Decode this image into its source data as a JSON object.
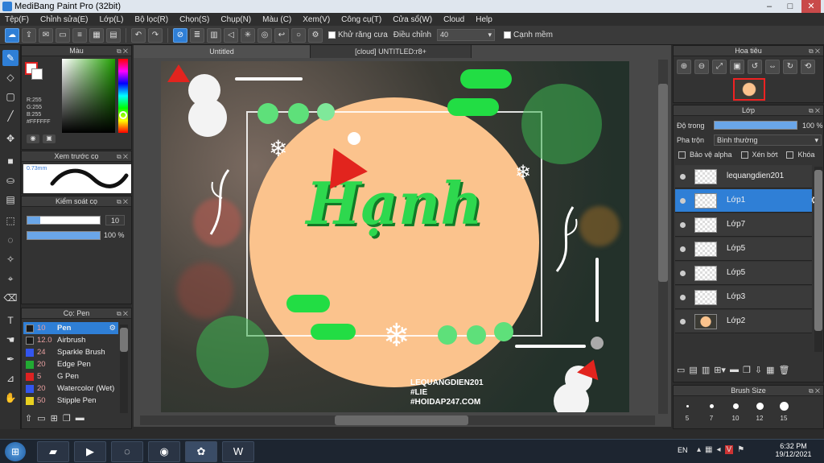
{
  "titlebar": {
    "title": "MediBang Paint Pro (32bit)",
    "min": "–",
    "max": "□",
    "close": "✕"
  },
  "menu": [
    "Tệp(F)",
    "Chỉnh sửa(E)",
    "Lớp(L)",
    "Bộ lọc(R)",
    "Chọn(S)",
    "Chụp(N)",
    "Màu (C)",
    "Xem(V)",
    "Công cụ(T)",
    "Cửa sổ(W)",
    "Cloud",
    "Help"
  ],
  "toolbar": {
    "antialias_label": "Khử răng cưa",
    "adjust_label": "Điều chỉnh",
    "adjust_value": "40",
    "sharp_label": "Cạnh mềm"
  },
  "color_panel": {
    "title": "Màu",
    "r": "R:255",
    "g": "G:255",
    "b": "B:255",
    "hex": "#FFFFFF"
  },
  "brush_preview": {
    "title": "Xem trước cọ",
    "size": "0.73mm"
  },
  "brush_control": {
    "title": "Kiểm soát cọ",
    "size_value": "10",
    "opacity_value": "100 %"
  },
  "brush_list": {
    "title": "Cọ: Pen",
    "items": [
      {
        "size": "10",
        "name": "Pen",
        "color": "#1a1a1a"
      },
      {
        "size": "12.0",
        "name": "Airbrush",
        "color": "#1a1a1a"
      },
      {
        "size": "24",
        "name": "Sparkle Brush",
        "color": "#3355ee"
      },
      {
        "size": "20",
        "name": "Edge Pen",
        "color": "#22aa33"
      },
      {
        "size": "5",
        "name": "G Pen",
        "color": "#dd2222"
      },
      {
        "size": "20",
        "name": "Watercolor (Wet)",
        "color": "#3355ee"
      },
      {
        "size": "50",
        "name": "Stipple Pen",
        "color": "#e8d020"
      }
    ]
  },
  "tabs": {
    "tab1": "Untitled",
    "tab2": "[cloud] UNTITLED:r8+"
  },
  "artwork": {
    "title": "Hạnh",
    "watermark1": "LEQUANGDIEN201",
    "watermark2": "#LIE",
    "watermark3": "#HOIDAP247.COM"
  },
  "navigator": {
    "title": "Hoa tiêu"
  },
  "layers": {
    "title": "Lớp",
    "opacity_label": "Độ trong",
    "opacity_value": "100 %",
    "blend_label": "Pha trộn",
    "blend_value": "Bình thường",
    "protect_alpha": "Bảo vệ alpha",
    "clipping": "Xén bớt",
    "lock": "Khóa",
    "items": [
      {
        "name": "lequangdien201"
      },
      {
        "name": "Lớp1"
      },
      {
        "name": "Lớp7"
      },
      {
        "name": "Lớp5"
      },
      {
        "name": "Lớp5"
      },
      {
        "name": "Lớp3"
      },
      {
        "name": "Lớp2"
      }
    ]
  },
  "brush_size": {
    "title": "Brush Size",
    "sizes": [
      "5",
      "7",
      "10",
      "12",
      "15"
    ]
  },
  "taskbar": {
    "lang": "EN",
    "time": "6:32 PM",
    "date": "19/12/2021"
  }
}
